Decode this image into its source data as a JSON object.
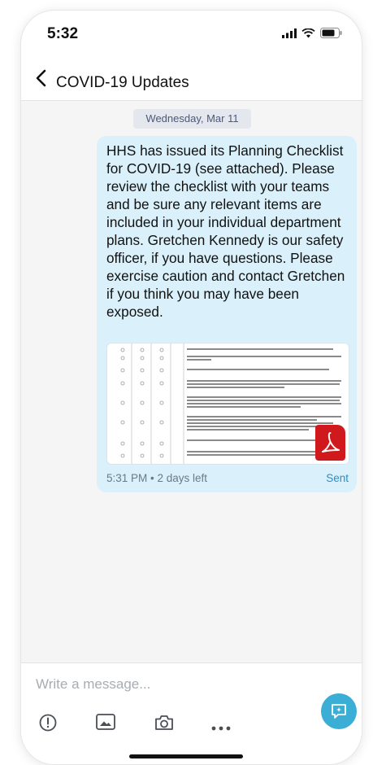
{
  "status_bar": {
    "time": "5:32"
  },
  "header": {
    "title": "COVID-19 Updates"
  },
  "thread": {
    "date_label": "Wednesday, Mar 11",
    "message": {
      "text": "HHS has issued its Planning Checklist for COVID-19 (see attached). Please review the checklist with your teams and be sure any relevant items are included in your individual department plans. Gretchen Kennedy is our safety officer, if you have questions. Please exercise caution and contact Gretchen if you think you may have been exposed.",
      "meta": "5:31 PM • 2 days left",
      "status": "Sent",
      "attachment_icon": "pdf-icon"
    }
  },
  "composer": {
    "placeholder": "Write a message...",
    "tools": [
      "alert-icon",
      "image-icon",
      "camera-icon",
      "more-icon"
    ],
    "send_icon": "chat-action-icon"
  },
  "colors": {
    "bubble": "#daf1fb",
    "accent": "#3aaed4",
    "status": "#2a8fc8",
    "pdf": "#d0191c"
  }
}
